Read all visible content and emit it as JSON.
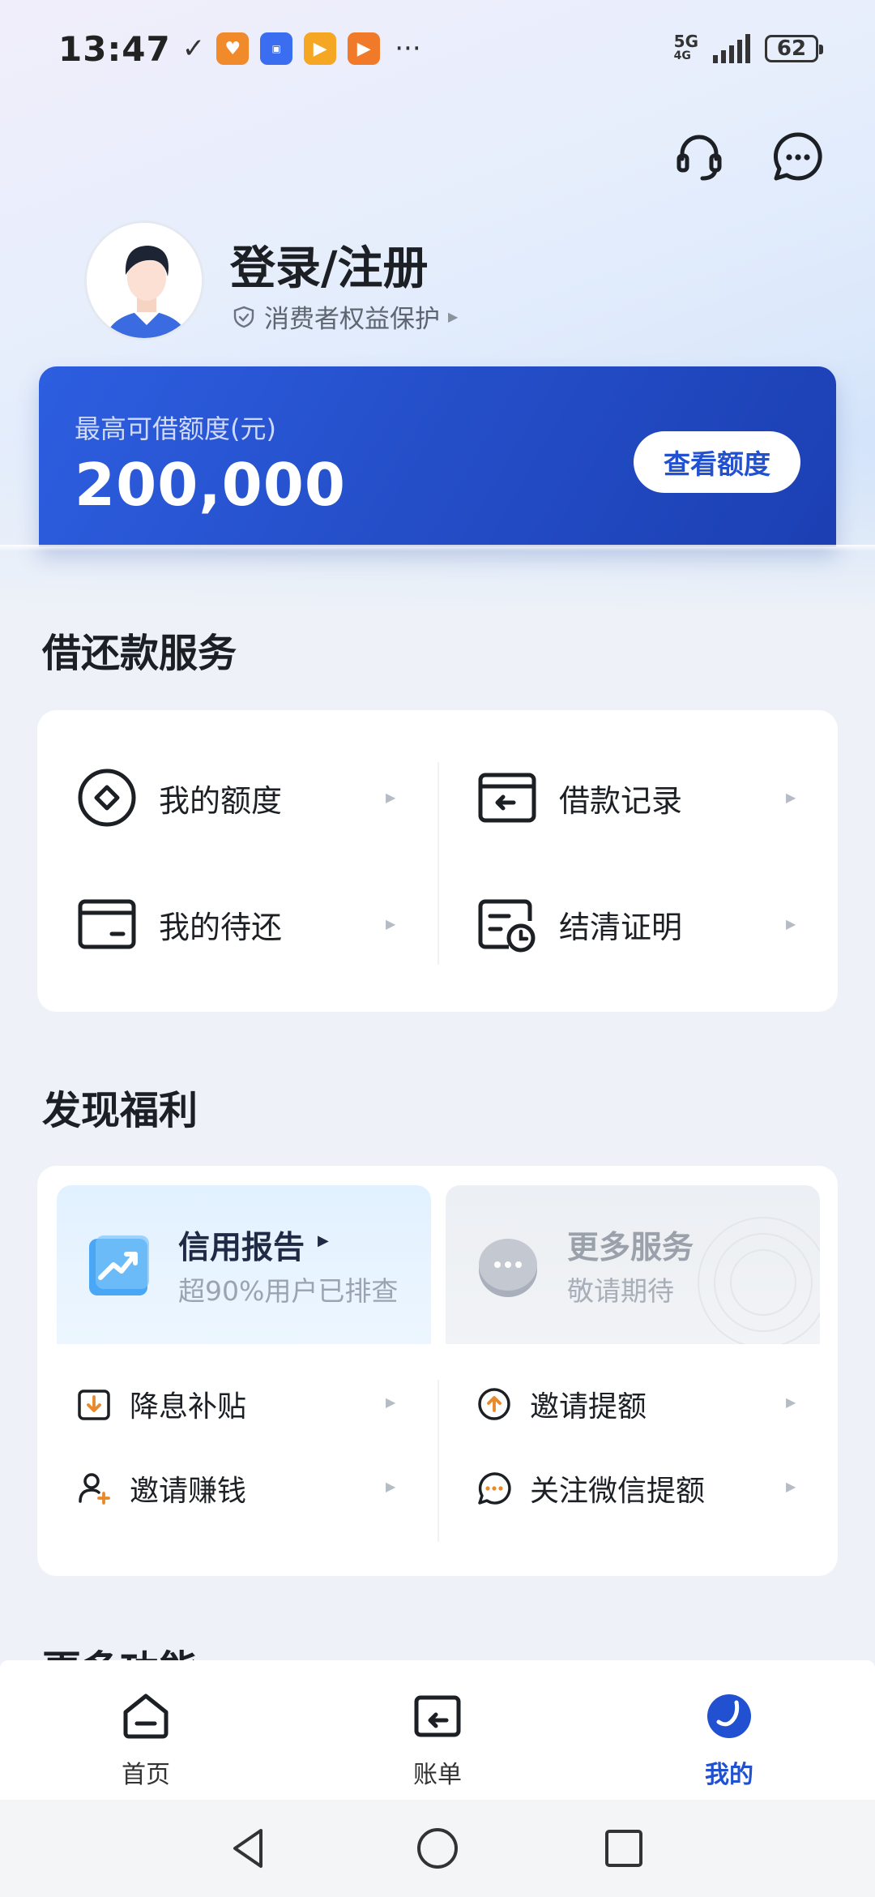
{
  "status_bar": {
    "time": "13:47",
    "network": "5G",
    "network_sub": "4G",
    "battery": "62",
    "more_dots": "···"
  },
  "header": {
    "support_icon": "headset-icon",
    "message_icon": "chat-bubble-icon"
  },
  "profile": {
    "login_label": "登录/注册",
    "protection_label": "消费者权益保护"
  },
  "credit": {
    "label": "最高可借额度(元)",
    "amount": "200,000",
    "button_label": "查看额度"
  },
  "loan_services": {
    "title": "借还款服务",
    "items": [
      {
        "label": "我的额度",
        "icon": "quota-icon"
      },
      {
        "label": "借款记录",
        "icon": "loan-record-icon"
      },
      {
        "label": "我的待还",
        "icon": "wallet-icon"
      },
      {
        "label": "结清证明",
        "icon": "settle-certificate-icon"
      }
    ]
  },
  "welfare": {
    "title": "发现福利",
    "cards": [
      {
        "title": "信用报告",
        "subtitle": "超90%用户已排查",
        "icon": "trend-chart-icon"
      },
      {
        "title": "更多服务",
        "subtitle": "敬请期待",
        "icon": "more-bubble-icon"
      }
    ],
    "items": [
      {
        "label": "降息补贴",
        "icon": "download-box-icon"
      },
      {
        "label": "邀请提额",
        "icon": "arrow-up-circle-icon"
      },
      {
        "label": "邀请赚钱",
        "icon": "user-add-icon"
      },
      {
        "label": "关注微信提额",
        "icon": "chat-dots-icon"
      }
    ]
  },
  "more_functions": {
    "title": "更多功能"
  },
  "bottom_nav": {
    "items": [
      {
        "label": "首页",
        "icon": "home-icon",
        "active": false
      },
      {
        "label": "账单",
        "icon": "bill-icon",
        "active": false
      },
      {
        "label": "我的",
        "icon": "profile-icon",
        "active": true
      }
    ]
  },
  "colors": {
    "primary": "#2150d0",
    "card_start": "#2d5ee0",
    "card_end": "#1c3fb3",
    "text": "#1c1f24",
    "orange": "#e8892c"
  }
}
